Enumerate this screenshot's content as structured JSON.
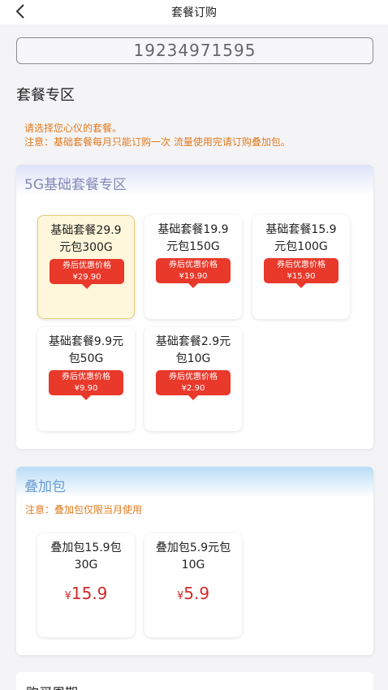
{
  "header": {
    "title": "套餐订购",
    "back_icon": "chevron-left-icon"
  },
  "phone": "19234971595",
  "section_title": "套餐专区",
  "notices": [
    "请选择您心仪的套餐。",
    "注意：基础套餐每月只能订购一次 流量使用完请订购叠加包。"
  ],
  "base": {
    "title": "5G基础套餐专区",
    "packages": [
      {
        "line1": "基础套餐29.9",
        "line2": "元包300G",
        "tag": "券后优惠价格",
        "price": "¥29.90",
        "selected": true
      },
      {
        "line1": "基础套餐19.9",
        "line2": "元包150G",
        "tag": "券后优惠价格",
        "price": "¥19.90"
      },
      {
        "line1": "基础套餐15.9",
        "line2": "元包100G",
        "tag": "券后优惠价格",
        "price": "¥15.90"
      },
      {
        "line1": "基础套餐9.9元",
        "line2": "包50G",
        "tag": "券后优惠价格",
        "price": "¥9.90"
      },
      {
        "line1": "基础套餐2.9元",
        "line2": "包10G",
        "tag": "券后优惠价格",
        "price": "¥2.90"
      }
    ]
  },
  "addon": {
    "title": "叠加包",
    "note": "注意：叠加包仅限当月使用",
    "packages": [
      {
        "line1": "叠加包15.9包",
        "line2": "30G",
        "currency": "¥",
        "price": "15.9"
      },
      {
        "line1": "叠加包5.9元包",
        "line2": "10G",
        "currency": "¥",
        "price": "5.9"
      }
    ]
  },
  "period": {
    "title": "购买周期"
  },
  "colors": {
    "accent_red": "#e8392b",
    "notice_orange": "#e07a1e",
    "selected_bg": "#fff7dc"
  }
}
